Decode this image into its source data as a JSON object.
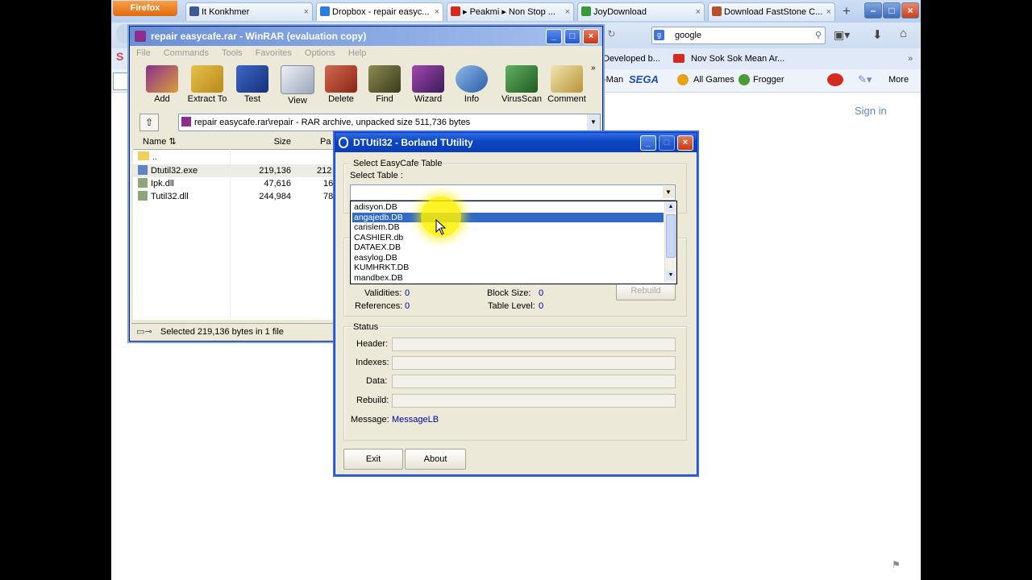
{
  "browser": {
    "firefox_label": "Firefox",
    "tabs": [
      {
        "label": "It Konkhmer",
        "icon_color": "#3b5998"
      },
      {
        "label": "Dropbox - repair easyc...",
        "icon_color": "#2a7de1"
      },
      {
        "label": "▸ Peakmi ▸ Non Stop ...",
        "icon_color": "#d62a1e"
      },
      {
        "label": "JoyDownload",
        "icon_color": "#3a9a3a"
      },
      {
        "label": "Download FastStone C...",
        "icon_color": "#b6512a"
      }
    ],
    "new_tab": "+",
    "search_value": "google",
    "bookmarks_row1": [
      "Developed b...",
      "Nov Sok Sok Mean Ar..."
    ],
    "bookmarks_row2": [
      "-Man",
      "SEGA",
      "All Games",
      "Frogger",
      "More"
    ],
    "sign_in": "Sign in"
  },
  "winrar": {
    "title": "repair easycafe.rar - WinRAR (evaluation copy)",
    "menu": [
      "File",
      "Commands",
      "Tools",
      "Favorites",
      "Options",
      "Help"
    ],
    "tools": [
      {
        "label": "Add",
        "color": "#8b2e8e"
      },
      {
        "label": "Extract To",
        "color": "#d9a531"
      },
      {
        "label": "Test",
        "color": "#2048a8"
      },
      {
        "label": "View",
        "color": "#b8c0d0"
      },
      {
        "label": "Delete",
        "color": "#b43c2c"
      },
      {
        "label": "Find",
        "color": "#6b6b3a"
      },
      {
        "label": "Wizard",
        "color": "#7a2c8a"
      },
      {
        "label": "Info",
        "color": "#3d7ac2"
      },
      {
        "label": "VirusScan",
        "color": "#3c8a3c"
      },
      {
        "label": "Comment",
        "color": "#c9a84c"
      }
    ],
    "path": "repair easycafe.rar\\repair - RAR archive, unpacked size 511,736 bytes",
    "columns": [
      "Name",
      "Size",
      "Pa"
    ],
    "files": [
      {
        "name": "..",
        "size": "",
        "packed": ""
      },
      {
        "name": "Dtutil32.exe",
        "size": "219,136",
        "packed": "212"
      },
      {
        "name": "Ipk.dll",
        "size": "47,616",
        "packed": "16"
      },
      {
        "name": "Tutil32.dll",
        "size": "244,984",
        "packed": "78"
      }
    ],
    "status": "Selected 219,136 bytes in 1 file"
  },
  "dtutil": {
    "title": "DTUtil32 - Borland TUtility",
    "group_table": "Select EasyCafe Table",
    "select_table_label": "Select Table :",
    "tables": [
      "adisyon.DB",
      "angajedb.DB",
      "carislem.DB",
      "CASHIER.db",
      "DATAEX.DB",
      "easylog.DB",
      "KUMHRKT.DB",
      "mandbex.DB"
    ],
    "selected_index": 1,
    "validities_label": "Validities:",
    "validities_value": "0",
    "references_label": "References:",
    "references_value": "0",
    "block_size_label": "Block Size:",
    "block_size_value": "0",
    "table_level_label": "Table Level:",
    "table_level_value": "0",
    "rebuild_btn": "Rebuild",
    "group_status": "Status",
    "header_label": "Header:",
    "indexes_label": "Indexes:",
    "data_label": "Data:",
    "rebuild_label": "Rebuild:",
    "message_label": "Message:",
    "message_value": "MessageLB",
    "exit_btn": "Exit",
    "about_btn": "About"
  }
}
